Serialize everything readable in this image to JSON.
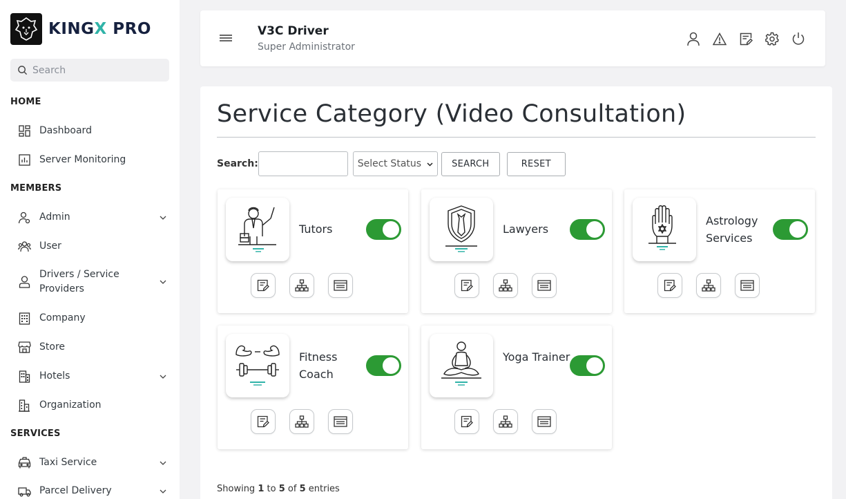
{
  "brand": {
    "name_part1": "KING",
    "name_x": "X",
    "name_part2": " PRO"
  },
  "sidebar": {
    "search_placeholder": "Search",
    "sections": {
      "home": "HOME",
      "members": "MEMBERS",
      "services": "SERVICES"
    },
    "items": {
      "dashboard": "Dashboard",
      "server_monitoring": "Server Monitoring",
      "admin": "Admin",
      "user": "User",
      "drivers": "Drivers / Service Providers",
      "company": "Company",
      "store": "Store",
      "hotels": "Hotels",
      "organization": "Organization",
      "taxi_service": "Taxi Service",
      "parcel_delivery": "Parcel Delivery"
    }
  },
  "header": {
    "title": "V3C Driver",
    "subtitle": "Super Administrator"
  },
  "main": {
    "page_title": "Service Category (Video Consultation)",
    "filter": {
      "search_label": "Search:",
      "search_value": "",
      "status_selected": "Select Status",
      "search_button": "SEARCH",
      "reset_button": "RESET"
    },
    "categories": [
      {
        "name": "Tutors",
        "icon": "tutor-icon",
        "enabled": true
      },
      {
        "name": "Lawyers",
        "icon": "shield-tie-icon",
        "enabled": true
      },
      {
        "name": "Astrology Services",
        "icon": "hamsa-hand-icon",
        "enabled": true
      },
      {
        "name": "Fitness Coach",
        "icon": "dumbbell-icon",
        "enabled": true
      },
      {
        "name": "Yoga Trainer",
        "icon": "meditation-icon",
        "enabled": true
      }
    ],
    "pagination": {
      "showing": "Showing",
      "from": "1",
      "to_word": "to",
      "to": "5",
      "of_word": "of",
      "total": "5",
      "entries": "entries"
    }
  },
  "colors": {
    "toggle_on": "#2c9a34",
    "brand_accent": "#30b3a8",
    "brand_dark": "#16213f"
  }
}
